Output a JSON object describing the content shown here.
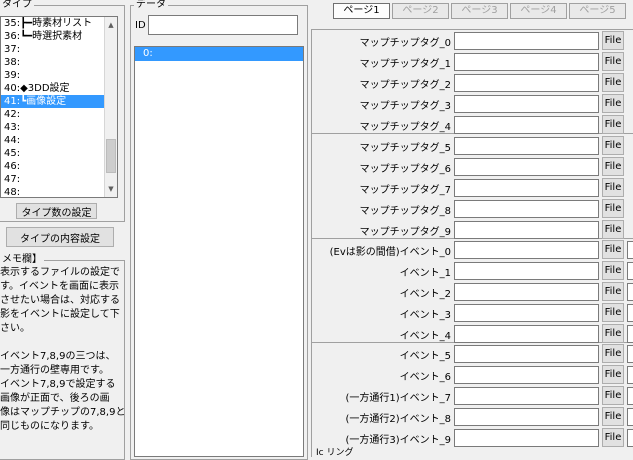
{
  "type_panel": {
    "legend": "タイプ",
    "items": [
      {
        "num": "35:",
        "label": "┣━時素材リスト"
      },
      {
        "num": "36:",
        "label": "┗━時選択素材"
      },
      {
        "num": "37:",
        "label": ""
      },
      {
        "num": "38:",
        "label": ""
      },
      {
        "num": "39:",
        "label": ""
      },
      {
        "num": "40:",
        "label": "◆3DD設定"
      },
      {
        "num": "41:",
        "label": "┗画像設定"
      },
      {
        "num": "42:",
        "label": ""
      },
      {
        "num": "43:",
        "label": ""
      },
      {
        "num": "44:",
        "label": ""
      },
      {
        "num": "45:",
        "label": ""
      },
      {
        "num": "46:",
        "label": ""
      },
      {
        "num": "47:",
        "label": ""
      },
      {
        "num": "48:",
        "label": ""
      }
    ],
    "type_count_button": "タイプ数の設定"
  },
  "type_content_button": "タイプの内容設定",
  "memo": {
    "legend": "メモ欄】",
    "lines": [
      "表示するファイルの設定で",
      "す。イベントを画面に表示",
      "させたい場合は、対応する",
      "影をイベントに設定して下",
      "さい。",
      "",
      "イベント7,8,9の三つは、",
      "一方通行の壁専用です。",
      "イベント7,8,9で設定する",
      "画像が正面で、後ろの画",
      "像はマップチップの7,8,9と",
      "同じものになります。"
    ]
  },
  "data_panel": {
    "legend": "データ",
    "id_label": "ID",
    "id_value": "",
    "items": [
      "0:"
    ]
  },
  "tabs": [
    "ページ1",
    "ページ2",
    "ページ3",
    "ページ4",
    "ページ5"
  ],
  "file_button": "File",
  "fields": [
    "マップチップタグ_0",
    "マップチップタグ_1",
    "マップチップタグ_2",
    "マップチップタグ_3",
    "マップチップタグ_4",
    "マップチップタグ_5",
    "マップチップタグ_6",
    "マップチップタグ_7",
    "マップチップタグ_8",
    "マップチップタグ_9",
    "(Evは影の間借)イベント_0",
    "イベント_1",
    "イベント_2",
    "イベント_3",
    "イベント_4",
    "イベント_5",
    "イベント_6",
    "(一方通行1)イベント_7",
    "(一方通行2)イベント_8",
    "(一方通行3)イベント_9"
  ],
  "bottom_label": "Ic リング"
}
